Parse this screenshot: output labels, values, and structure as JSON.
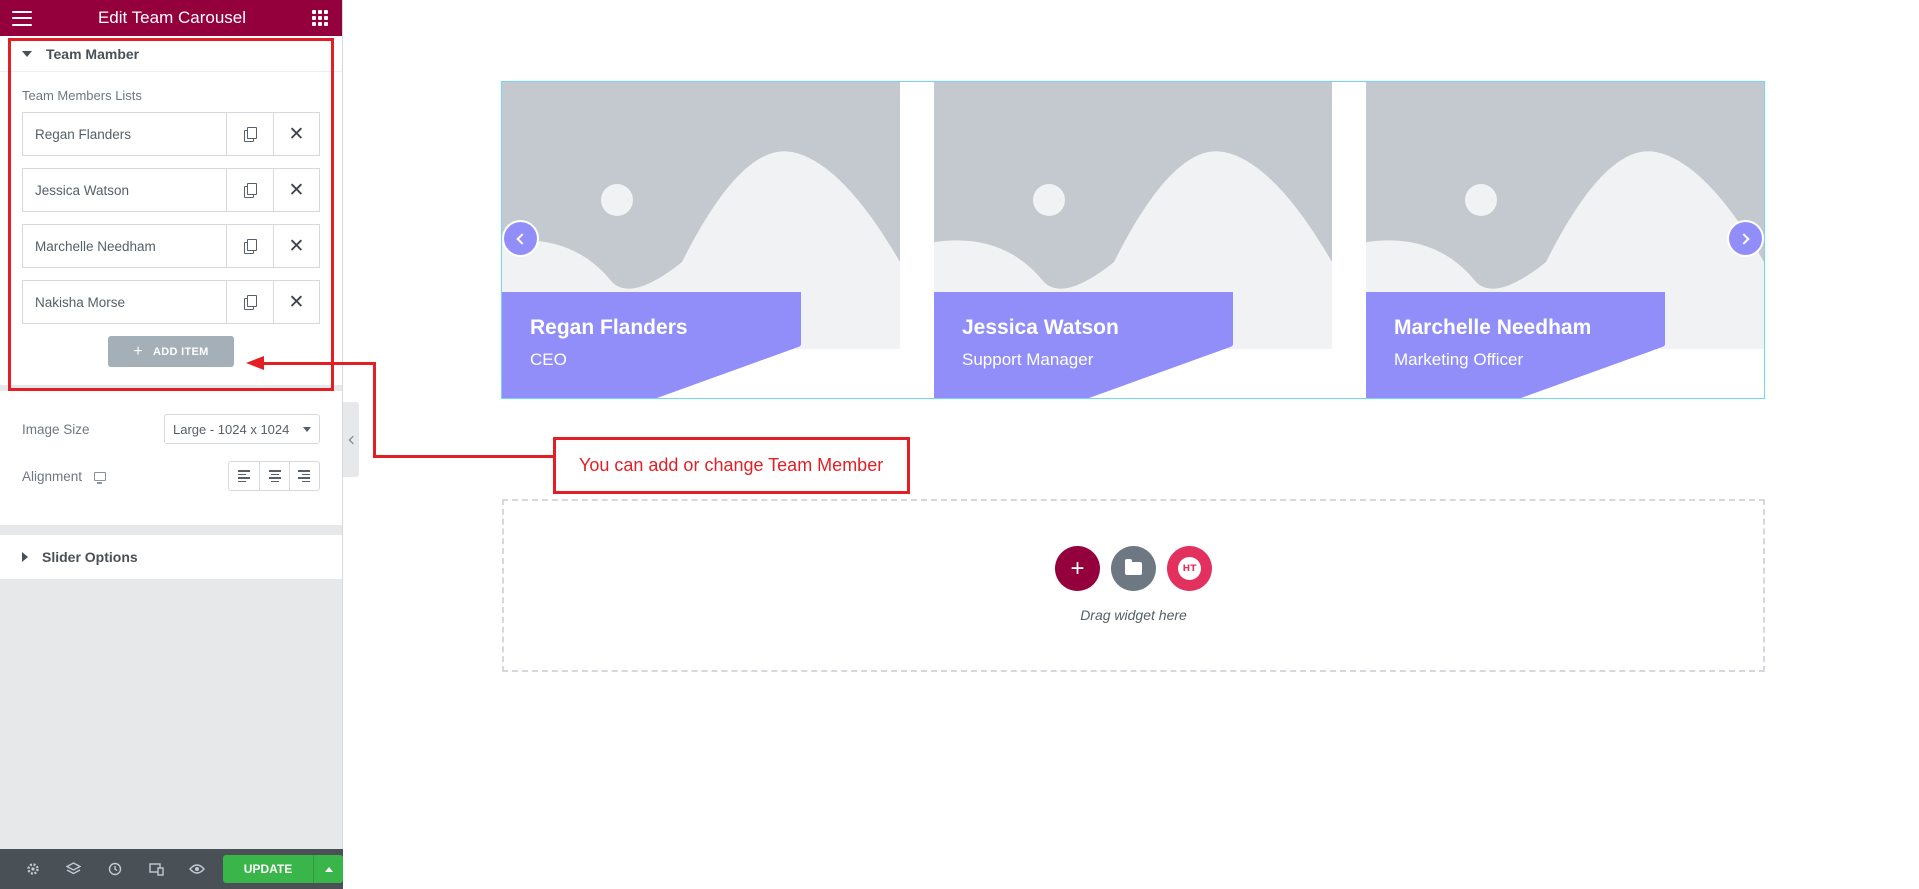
{
  "panel": {
    "title": "Edit Team Carousel",
    "team_section_title": "Team Mamber",
    "list_label": "Team Members Lists",
    "items": [
      {
        "label": "Regan Flanders"
      },
      {
        "label": "Jessica Watson"
      },
      {
        "label": "Marchelle Needham"
      },
      {
        "label": "Nakisha Morse"
      }
    ],
    "add_item_label": "ADD ITEM",
    "image_size_label": "Image Size",
    "image_size_value": "Large - 1024 x 1024",
    "alignment_label": "Alignment",
    "slider_section_title": "Slider Options"
  },
  "footer": {
    "icons": [
      "gear-icon",
      "layers-icon",
      "history-icon",
      "responsive-icon",
      "eye-icon"
    ],
    "update_label": "UPDATE"
  },
  "carousel": {
    "slides": [
      {
        "name": "Regan Flanders",
        "role": "CEO"
      },
      {
        "name": "Jessica Watson",
        "role": "Support Manager"
      },
      {
        "name": "Marchelle Needham",
        "role": "Marketing Officer"
      }
    ]
  },
  "callout": {
    "text": "You can add or change Team Member"
  },
  "dropzone": {
    "text": "Drag widget here",
    "ht_badge": "HT"
  },
  "colors": {
    "brand": "#93003c",
    "accent": "#918ef9",
    "annotation": "#e31e24",
    "update": "#39b54a"
  }
}
